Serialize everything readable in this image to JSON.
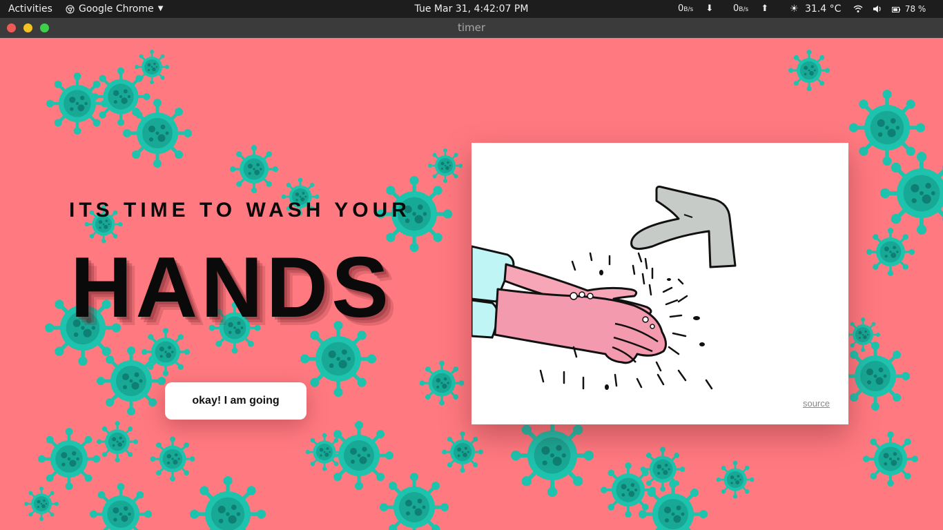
{
  "topbar": {
    "activities": "Activities",
    "app_name": "Google Chrome",
    "clock": "Tue Mar 31,  4:42:07 PM",
    "net_down_value": "0",
    "net_down_unit": "B/s",
    "net_up_value": "0",
    "net_up_unit": "B/s",
    "temperature": "31.4 °C",
    "battery": "78 %"
  },
  "window": {
    "title": "timer"
  },
  "page": {
    "subheading": "ITS TIME TO WASH YOUR",
    "heading": "HANDS",
    "button_label": "okay! I am going",
    "image_alt": "Hands being washed under a tap",
    "source_link": "source"
  },
  "colors": {
    "background": "#ff7a80",
    "virus": "#1ec3ad",
    "virus_dark": "#0e8f80",
    "text": "#0a0a0a"
  },
  "icons": {
    "chrome": "chrome-icon",
    "dropdown": "chevron-down-icon",
    "download": "arrow-down-icon",
    "upload": "arrow-up-icon",
    "weather": "sun-icon",
    "wifi": "wifi-icon",
    "volume": "volume-icon",
    "battery": "battery-icon"
  }
}
